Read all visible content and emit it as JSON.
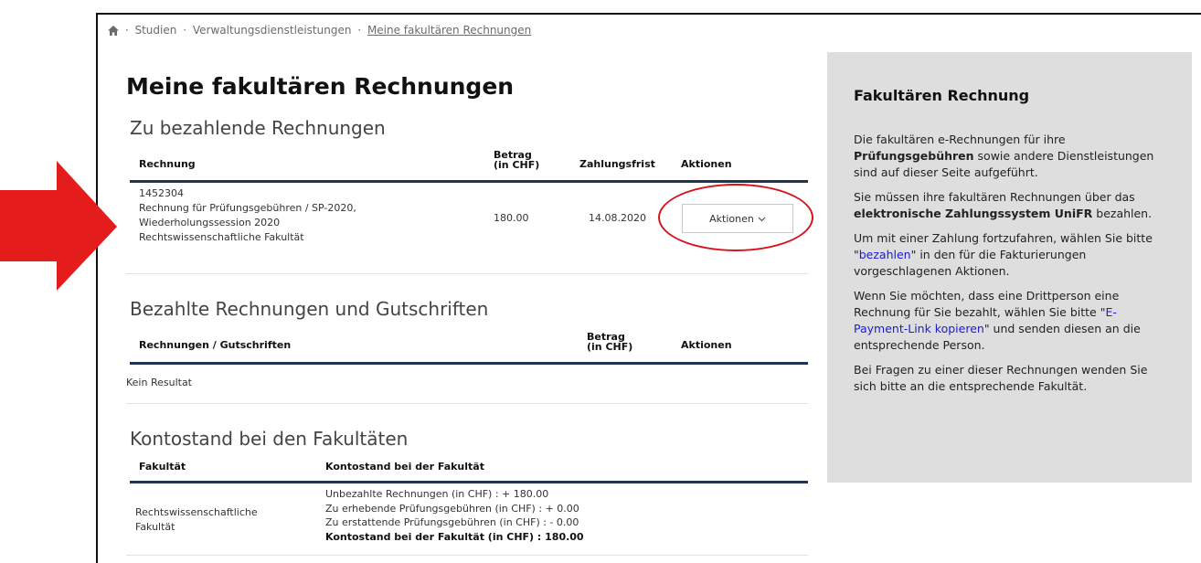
{
  "breadcrumb": {
    "home_icon": "home-icon",
    "sep": "·",
    "items": [
      "Studien",
      "Verwaltungsdienstleistungen",
      "Meine fakultären Rechnungen"
    ]
  },
  "page_title": "Meine fakultären Rechnungen",
  "unpaid": {
    "heading": "Zu bezahlende Rechnungen",
    "columns": {
      "invoice": "Rechnung",
      "amount": "Betrag (in CHF)",
      "due": "Zahlungsfrist",
      "actions": "Aktionen"
    },
    "rows": [
      {
        "number": "1452304",
        "description": "Rechnung für Prüfungsgebühren / SP-2020, Wiederholungssession 2020",
        "faculty": "Rechtswissenschaftliche Fakultät",
        "amount": "180.00",
        "due": "14.08.2020",
        "action_label": "Aktionen",
        "action_icon": "chevron-down-icon"
      }
    ]
  },
  "paid": {
    "heading": "Bezahlte Rechnungen und Gutschriften",
    "columns": {
      "invoice": "Rechnungen / Gutschriften",
      "amount": "Betrag (in CHF)",
      "actions": "Aktionen"
    },
    "empty": "Kein Resultat"
  },
  "balance": {
    "heading": "Kontostand bei den Fakultäten",
    "columns": {
      "faculty": "Fakultät",
      "balance": "Kontostand bei der Fakultät"
    },
    "rows": [
      {
        "faculty": "Rechtswissenschaftliche Fakultät",
        "lines": [
          "Unbezahlte Rechnungen (in CHF) : + 180.00",
          "Zu erhebende Prüfungsgebühren (in CHF) : + 0.00",
          "Zu erstattende Prüfungsgebühren (in CHF) : - 0.00"
        ],
        "total": "Kontostand bei der Fakultät (in CHF) : 180.00"
      }
    ]
  },
  "sidebar": {
    "title": "Fakultären Rechnung",
    "p1_pre": "Die fakultären e-Rechnungen für ihre ",
    "p1_bold": "Prüfungsgebühren",
    "p1_post": " sowie andere Dienstleistungen sind auf dieser Seite aufgeführt.",
    "p2_pre": "Sie müssen ihre fakultären Rechnungen über das ",
    "p2_bold": "elektronische Zahlungssystem UniFR",
    "p2_post": " bezahlen.",
    "p3_pre": "Um mit einer Zahlung fortzufahren, wählen Sie bitte \"",
    "p3_link": "bezahlen",
    "p3_post": "\" in den für die Fakturierungen vorgeschlagenen Aktionen.",
    "p4_pre": "Wenn Sie möchten, dass eine Drittperson eine Rechnung für Sie bezahlt, wählen Sie bitte \"",
    "p4_link": "E-Payment-Link kopieren",
    "p4_post": "\" und senden diesen an die entsprechende Person.",
    "p5": "Bei Fragen zu einer dieser Rechnungen wenden Sie sich bitte an die entsprechende Fakultät."
  },
  "colors": {
    "annotation_red": "#e41c1c",
    "header_rule": "#1f3552",
    "sidebar_bg": "#dedede",
    "link": "#1b1bd6"
  }
}
